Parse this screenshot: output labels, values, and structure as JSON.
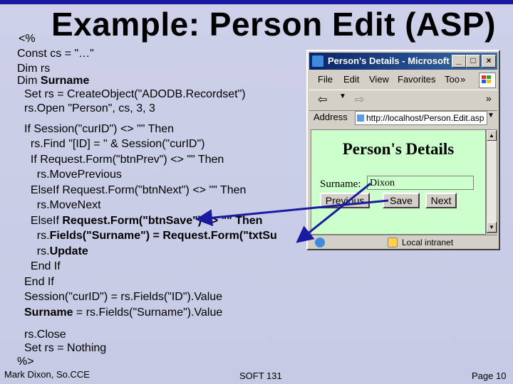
{
  "slide": {
    "title": "Example: Person Edit (ASP)",
    "code_open": "<%",
    "code_lines": [
      {
        "text": "Const cs = \"…\"",
        "bold": false
      },
      {
        "text": "Dim rs",
        "bold": false
      },
      {
        "pre": "Dim ",
        "bold_text": "Surname"
      },
      {
        "text": "Set rs = CreateObject(\"ADODB.Recordset\")",
        "bold": false
      },
      {
        "text": "rs.Open \"Person\", cs, 3, 3",
        "bold": false
      }
    ],
    "code_block": [
      "If Session(\"curID\") <> \"\" Then",
      "  rs.Find \"[ID] = \" & Session(\"curID\")",
      "  If Request.Form(\"btnPrev\") <> \"\" Then",
      "    rs.MovePrevious",
      "  ElseIf Request.Form(\"btnNext\") <> \"\" Then",
      "    rs.MoveNext",
      "  ElseIf ",
      "    rs.",
      "    rs.",
      "  End If",
      "End If",
      "Session(\"curID\") = rs.Fields(\"ID\").Value",
      "Surname = rs.Fields(\"Surname\").Value"
    ],
    "code_bold": {
      "elseif_save": "Request.Form(\"btnSave\") <> \"\" Then",
      "fields_line": "Fields(\"Surname\") = Request.Form(\"txtSu",
      "update": "Update",
      "surname_assign": "Surname",
      "surname_rest": " = rs.Fields(\"Surname\").Value"
    },
    "code_close_lines": [
      "rs.Close",
      "Set rs = Nothing",
      "%>"
    ],
    "footer": {
      "author": "Mark Dixon, So.CCE",
      "course": "SOFT 131",
      "page": "Page 10"
    }
  },
  "browser": {
    "window_title": "Person's Details - Microsoft I...",
    "menu": [
      "File",
      "Edit",
      "View",
      "Favorites",
      "Too"
    ],
    "menu_more": "»",
    "toolbar_back": "⇦",
    "toolbar_fwd": "⇨",
    "toolbar_more": "»",
    "address_label": "Address",
    "address_value": "http://localhost/Person.Edit.asp",
    "page_heading": "Person's Details",
    "surname_label": "Surname:",
    "surname_value": "Dixon",
    "buttons": {
      "previous": "Previous",
      "save": "Save",
      "next": "Next"
    },
    "status_zone": "Local intranet"
  },
  "colors": {
    "slide_bg": "#c9cde6",
    "page_bg": "#ccffcc",
    "title_bar": "#0a246a",
    "arrow": "#1a1aa0"
  }
}
